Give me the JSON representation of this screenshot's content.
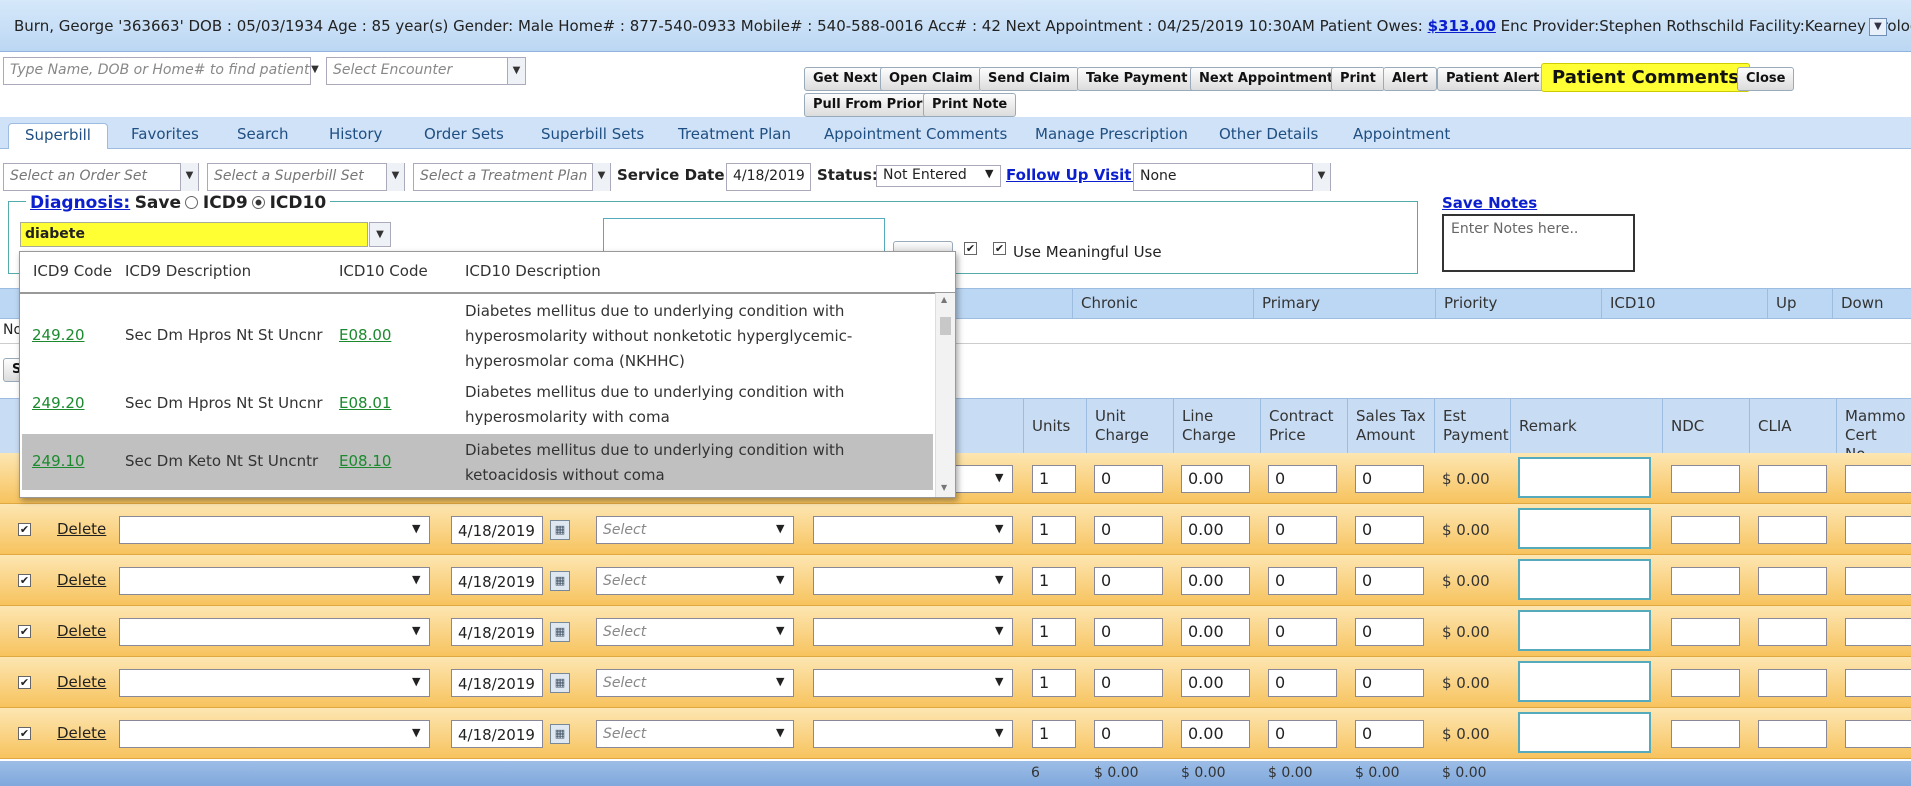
{
  "patient_bar": {
    "info": "Burn, George '363663' DOB : 05/03/1934 Age : 85 year(s) Gender: Male Home# : 877-540-0933 Mobile# : 540-588-0016 Acc# : 42 Next Appointment : 04/25/2019 10:30AM Patient Owes: ",
    "owes": "$313.00",
    "info2": " Enc Provider:Stephen Rothschild Facility:Kearney Urology",
    "menu_glyph": "▼"
  },
  "toolbar": {
    "find_placeholder": "Type Name, DOB or Home# to find patient",
    "encounter_placeholder": "Select Encounter",
    "buttons": [
      "Get Next",
      "Open Claim",
      "Send Claim",
      "Take Payment",
      "Next Appointment",
      "Print",
      "Alert",
      "Patient Alert",
      "Patient Comments",
      "Close"
    ],
    "buttons2": [
      "Pull From Prior",
      "Print Note"
    ]
  },
  "tabs": [
    "Superbill",
    "Favorites",
    "Search",
    "History",
    "Order Sets",
    "Superbill Sets",
    "Treatment Plan",
    "Appointment Comments",
    "Manage Prescription",
    "Other Details",
    "Appointment"
  ],
  "filters": {
    "order_set": "Select an Order Set",
    "superbill_set": "Select a Superbill Set",
    "treatment_plan": "Select a Treatment Plan",
    "service_date_label": "Service Date:",
    "service_date": "4/18/2019",
    "status_label": "Status:",
    "status": "Not Entered",
    "follow_up_label": "Follow Up Visit:",
    "follow_up": "None"
  },
  "diagnosis": {
    "title": "Diagnosis:",
    "save": "Save",
    "icd9": "ICD9",
    "icd10": "ICD10",
    "search_value": "diabete",
    "meaningful_use": "Use Meaningful Use",
    "save_notes": "Save Notes",
    "notes_placeholder": "Enter Notes here.."
  },
  "diag_table_headers": [
    "Chronic",
    "Primary",
    "Priority",
    "ICD10",
    "Up",
    "Down"
  ],
  "diag_row_text": "No",
  "s_button": "S",
  "popup": {
    "headers": [
      "ICD9 Code",
      "ICD9 Description",
      "ICD10 Code",
      "ICD10 Description"
    ],
    "rows": [
      {
        "icd9": "249.20",
        "icd9_desc": "Sec Dm Hpros Nt St Uncnr",
        "icd10": "E08.00",
        "icd10_desc": "Diabetes mellitus due to underlying condition with hyperosmolarity without nonketotic hyperglycemic-hyperosmolar coma (NKHHC)"
      },
      {
        "icd9": "249.20",
        "icd9_desc": "Sec Dm Hpros Nt St Uncnr",
        "icd10": "E08.01",
        "icd10_desc": "Diabetes mellitus due to underlying condition with hyperosmolarity with coma"
      },
      {
        "icd9": "249.10",
        "icd9_desc": "Sec Dm Keto Nt St Uncntr",
        "icd10": "E08.10",
        "icd10_desc": "Diabetes mellitus due to underlying condition with ketoacidosis without coma"
      }
    ]
  },
  "proc_headers": [
    "Units",
    "Unit Charge",
    "Line Charge",
    "Contract Price",
    "Sales Tax Amount",
    "Est Payment",
    "Remark",
    "NDC",
    "CLIA",
    "Mammo Cert No"
  ],
  "proc_rows": [
    {
      "delete": "",
      "date": "",
      "select": "",
      "units": "1",
      "unit_charge": "0",
      "line_charge": "0.00",
      "contract": "0",
      "tax": "0",
      "est": "$ 0.00"
    },
    {
      "delete": "Delete",
      "date": "4/18/2019",
      "select": "Select",
      "units": "1",
      "unit_charge": "0",
      "line_charge": "0.00",
      "contract": "0",
      "tax": "0",
      "est": "$ 0.00"
    },
    {
      "delete": "Delete",
      "date": "4/18/2019",
      "select": "Select",
      "units": "1",
      "unit_charge": "0",
      "line_charge": "0.00",
      "contract": "0",
      "tax": "0",
      "est": "$ 0.00"
    },
    {
      "delete": "Delete",
      "date": "4/18/2019",
      "select": "Select",
      "units": "1",
      "unit_charge": "0",
      "line_charge": "0.00",
      "contract": "0",
      "tax": "0",
      "est": "$ 0.00"
    },
    {
      "delete": "Delete",
      "date": "4/18/2019",
      "select": "Select",
      "units": "1",
      "unit_charge": "0",
      "line_charge": "0.00",
      "contract": "0",
      "tax": "0",
      "est": "$ 0.00"
    },
    {
      "delete": "Delete",
      "date": "4/18/2019",
      "select": "Select",
      "units": "1",
      "unit_charge": "0",
      "line_charge": "0.00",
      "contract": "0",
      "tax": "0",
      "est": "$ 0.00"
    }
  ],
  "totals": {
    "units": "6",
    "unit_charge": "$ 0.00",
    "line_charge": "$ 0.00",
    "contract": "$ 0.00",
    "tax": "$ 0.00",
    "est": "$ 0.00"
  },
  "colors": {
    "accent": "#bcd7f3",
    "row": "#f7c35e",
    "highlight": "#ffff33",
    "link": "#0b1fcf",
    "code_link": "#1b8a2e"
  }
}
